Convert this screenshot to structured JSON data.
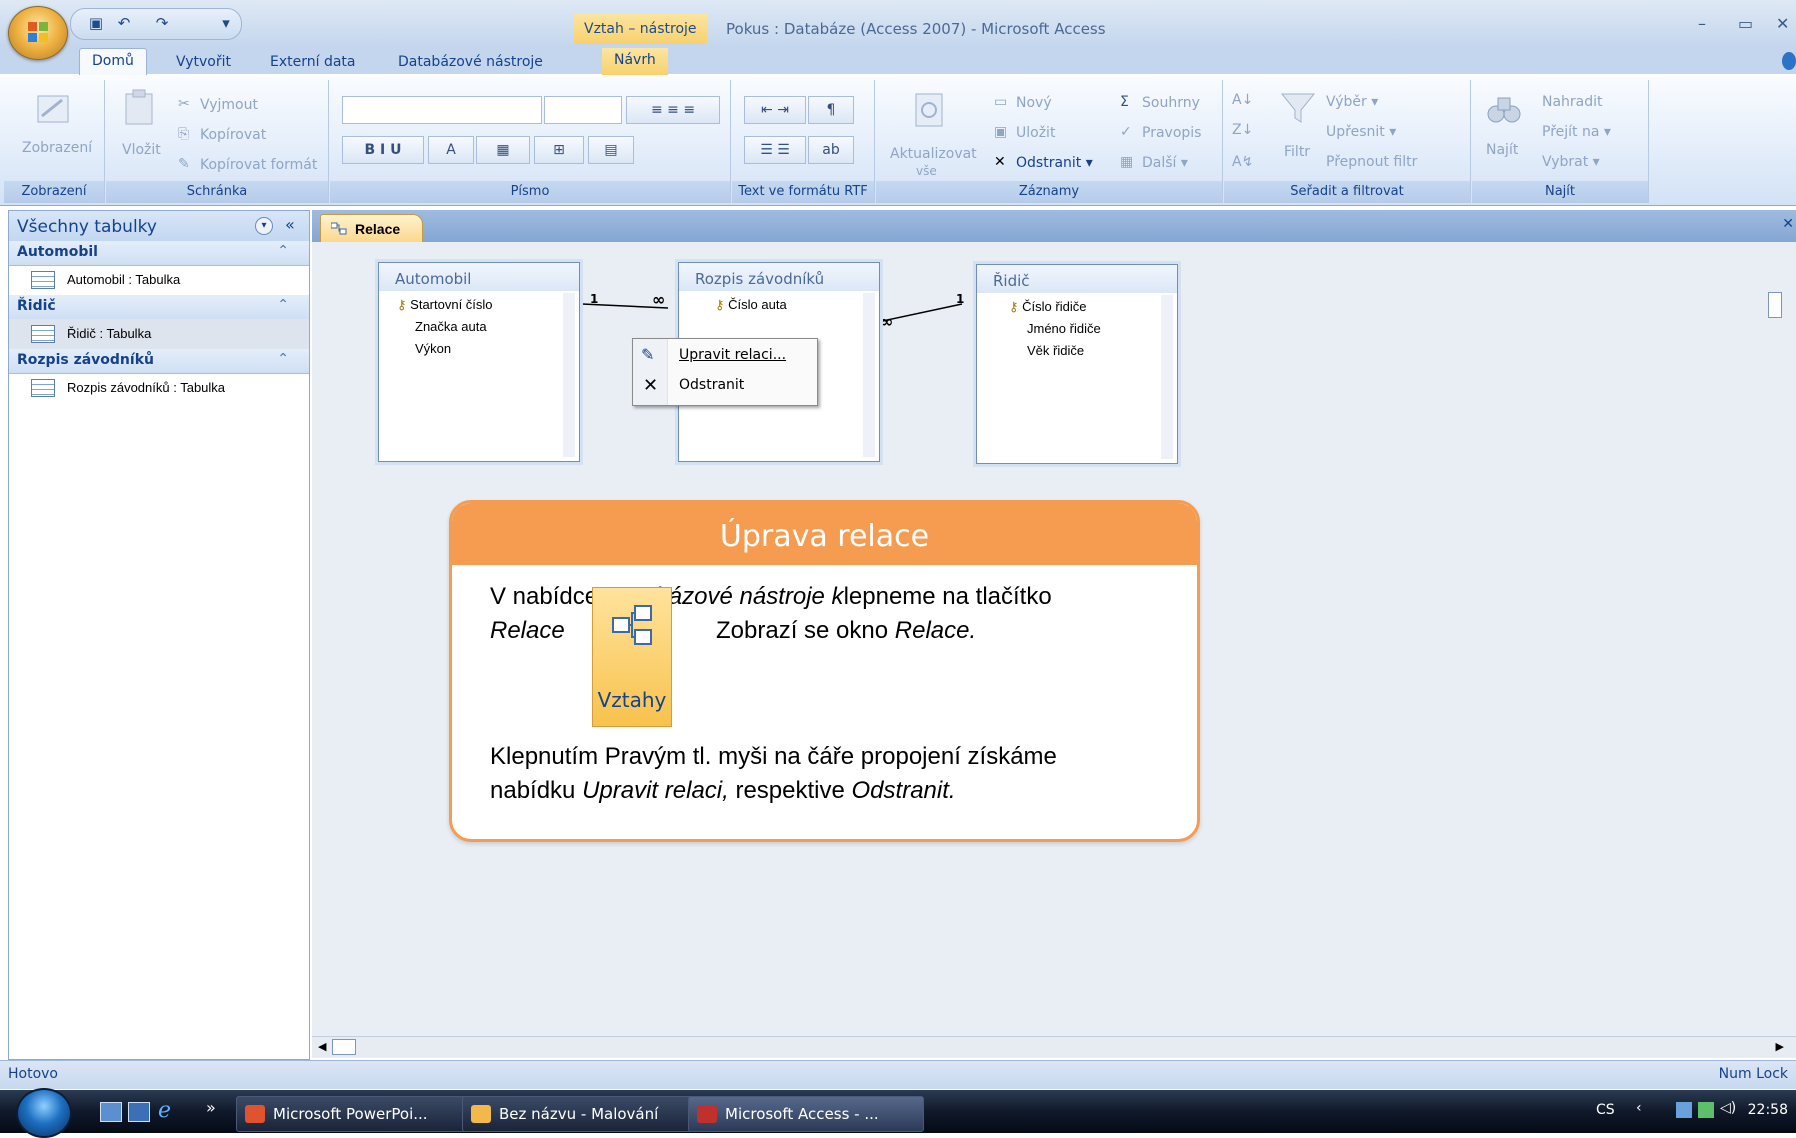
{
  "title_bar": {
    "context_tab_group": "Vztah – nástroje",
    "app_title": "Pokus : Databáze (Access 2007) - Microsoft Access"
  },
  "tabs": {
    "home": "Domů",
    "create": "Vytvořit",
    "external": "Externí data",
    "dbtools": "Databázové nástroje",
    "design": "Návrh"
  },
  "ribbon": {
    "views": {
      "button": "Zobrazení",
      "label": "Zobrazení"
    },
    "clipboard": {
      "paste": "Vložit",
      "cut": "Vyjmout",
      "copy": "Kopírovat",
      "format_painter": "Kopírovat formát",
      "label": "Schránka"
    },
    "font": {
      "label": "Písmo"
    },
    "rtf": {
      "label": "Text ve formátu RTF"
    },
    "records": {
      "refresh": "Aktualizovat",
      "refresh_sub": "vše",
      "new": "Nový",
      "save": "Uložit",
      "delete": "Odstranit",
      "totals": "Souhrny",
      "spelling": "Pravopis",
      "more": "Další",
      "label": "Záznamy"
    },
    "sort_filter": {
      "filter": "Filtr",
      "selection": "Výběr",
      "advanced": "Upřesnit",
      "toggle": "Přepnout filtr",
      "label": "Seřadit a filtrovat"
    },
    "find": {
      "find": "Najít",
      "replace": "Nahradit",
      "goto": "Přejít na",
      "select": "Vybrat",
      "label": "Najít"
    }
  },
  "nav_pane": {
    "title": "Všechny tabulky",
    "groups": [
      {
        "name": "Automobil",
        "item": "Automobil : Tabulka"
      },
      {
        "name": "Řidič",
        "item": "Řidič : Tabulka"
      },
      {
        "name": "Rozpis závodníků",
        "item": "Rozpis závodníků : Tabulka"
      }
    ]
  },
  "document": {
    "tab": "Relace",
    "tables": [
      {
        "name": "Automobil",
        "fields": [
          "Startovní číslo",
          "Značka auta",
          "Výkon"
        ]
      },
      {
        "name": "Rozpis závodníků",
        "fields": [
          "Číslo auta"
        ]
      },
      {
        "name": "Řidič",
        "fields": [
          "Číslo řidiče",
          "Jméno řidiče",
          "Věk řidiče"
        ]
      }
    ],
    "relation_labels": {
      "one": "1",
      "many": "∞"
    },
    "context_menu": {
      "edit": "Upravit relaci...",
      "delete": "Odstranit"
    }
  },
  "callout": {
    "title": "Úprava relace",
    "line1_a": "V nabídce ",
    "line1_em": "Databázové nástroje k",
    "line1_b": "lepneme na tlačítko",
    "line2_em": "Relace",
    "line2_b": "Zobrazí se okno ",
    "line2_em2": "Relace.",
    "button_label": "Vztahy",
    "line3": "Klepnutím Pravým tl. myši na čáře propojení získáme",
    "line4_a": "nabídku ",
    "line4_em": "Upravit relaci,",
    "line4_b": " respektive ",
    "line4_em2": "Odstranit."
  },
  "status": {
    "left": "Hotovo",
    "right": "Num Lock"
  },
  "taskbar": {
    "items": [
      {
        "label": "Microsoft PowerPoi...",
        "color": "#e0532f"
      },
      {
        "label": "Bez názvu - Malování",
        "color": "#f2b84a"
      },
      {
        "label": "Microsoft Access - ...",
        "color": "#c0312d"
      }
    ],
    "lang": "CS",
    "clock": "22:58"
  }
}
